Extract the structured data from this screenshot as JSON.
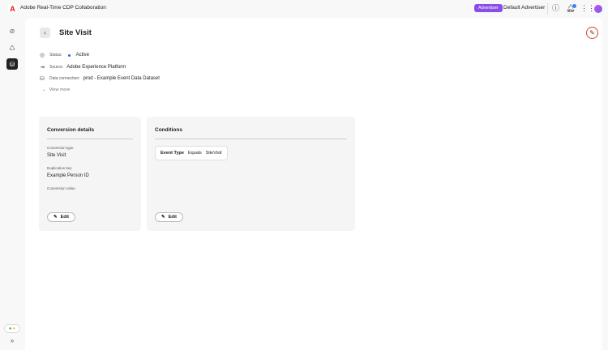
{
  "header": {
    "app_title": "Adobe Real-Time CDP Collaboration",
    "role_badge": "Advertiser",
    "account": "Default Advertiser"
  },
  "page": {
    "title": "Site Visit",
    "meta": {
      "status_label": "Status:",
      "status_value": "Active",
      "source_label": "Source:",
      "source_value": "Adobe Experience Platform",
      "connection_label": "Data connection:",
      "connection_value": "prod - Example Event Data Dataset",
      "view_more": "View more"
    }
  },
  "conversion_details": {
    "title": "Conversion details",
    "type_label": "Conversion type",
    "type_value": "Site Visit",
    "dedup_label": "Duplication key",
    "dedup_value": "Example Person ID",
    "value_label": "Conversion value",
    "edit": "Edit"
  },
  "conditions": {
    "title": "Conditions",
    "field": "Event Type",
    "operator": "Equals",
    "value": "SiteVisit",
    "edit": "Edit"
  },
  "colors": {
    "badge": "#8a4ee6",
    "accent": "#3b5ee6",
    "highlight": "#e53935"
  }
}
